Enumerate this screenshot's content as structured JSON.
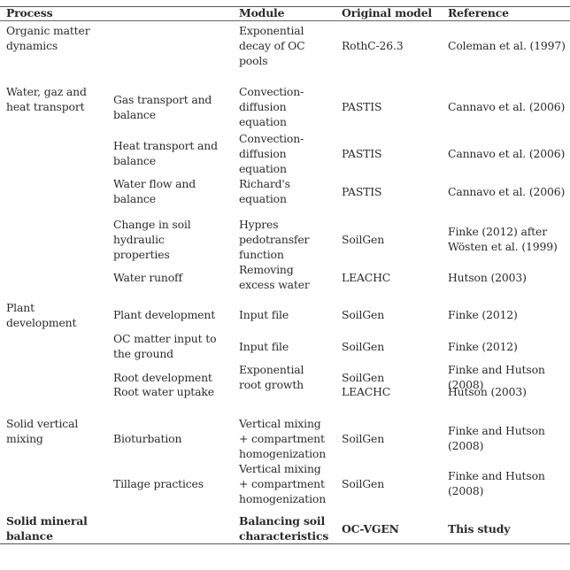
{
  "table": {
    "headers": {
      "process": "Process",
      "submodule": "",
      "module": "Module",
      "original_model": "Original model",
      "reference": "Reference"
    },
    "rows": [
      {
        "process": [
          "Organic matter",
          "dynamics"
        ],
        "submodule": [],
        "module": [
          "Exponential",
          "decay of OC",
          "pools"
        ],
        "original_model": [
          "RothC-26.3"
        ],
        "reference": [
          "Coleman et al.  (1997)"
        ]
      },
      {
        "process": [
          "Water, gaz and",
          "heat transport"
        ],
        "submodule": [
          "Gas transport and",
          "balance"
        ],
        "module": [
          "Convection-",
          "diffusion",
          "equation"
        ],
        "original_model": [
          "PASTIS"
        ],
        "reference": [
          "Cannavo et al. (2006)"
        ]
      },
      {
        "process": [],
        "submodule": [
          "Heat transport and",
          "balance"
        ],
        "module": [
          "Convection-",
          "diffusion",
          "equation"
        ],
        "original_model": [
          "PASTIS"
        ],
        "reference": [
          "Cannavo et al. (2006)"
        ]
      },
      {
        "process": [],
        "submodule": [
          "Water flow and",
          "balance"
        ],
        "module": [
          "Richard's",
          "equation"
        ],
        "original_model": [
          "PASTIS"
        ],
        "reference": [
          "Cannavo et al. (2006)"
        ]
      },
      {
        "process": [],
        "submodule": [
          "Change in soil",
          "hydraulic",
          "properties"
        ],
        "module": [
          "Hypres",
          "pedotransfer",
          "function"
        ],
        "original_model": [
          "SoilGen"
        ],
        "reference": [
          "Finke (2012) after",
          "Wösten et al. (1999)"
        ]
      },
      {
        "process": [],
        "submodule": [
          "Water runoff"
        ],
        "module": [
          "Removing",
          "excess water"
        ],
        "original_model": [
          "LEACHC"
        ],
        "reference": [
          "Hutson (2003)"
        ]
      },
      {
        "process": [
          "Plant",
          "development"
        ],
        "submodule": [
          "Plant development"
        ],
        "module": [
          "Input file"
        ],
        "original_model": [
          "SoilGen"
        ],
        "reference": [
          "Finke (2012)"
        ]
      },
      {
        "process": [],
        "submodule": [
          "OC matter input to",
          "the ground"
        ],
        "module": [
          "Input file"
        ],
        "original_model": [
          "SoilGen"
        ],
        "reference": [
          "Finke (2012)"
        ]
      },
      {
        "process": [],
        "submodule": [
          "Root development"
        ],
        "module": [
          "Exponential",
          "root growth"
        ],
        "original_model": [
          "SoilGen"
        ],
        "reference": [
          "Finke and Hutson",
          "(2008)"
        ]
      },
      {
        "process": [],
        "submodule": [
          "Root water uptake"
        ],
        "module": [],
        "original_model": [
          "LEACHC"
        ],
        "reference": [
          "Hutson (2003)"
        ]
      },
      {
        "process": [
          "Solid vertical",
          "mixing"
        ],
        "submodule": [
          "Bioturbation"
        ],
        "module": [
          "Vertical mixing",
          "+ compartment",
          "homogenization"
        ],
        "original_model": [
          "SoilGen"
        ],
        "reference": [
          "Finke and Hutson",
          "(2008)"
        ]
      },
      {
        "process": [],
        "submodule": [
          "Tillage practices"
        ],
        "module": [
          "Vertical mixing",
          "+ compartment",
          "homogenization"
        ],
        "original_model": [
          "SoilGen"
        ],
        "reference": [
          "Finke and Hutson",
          "(2008)"
        ]
      },
      {
        "process": [
          "Solid mineral",
          "balance"
        ],
        "submodule": [],
        "module": [
          "Balancing soil",
          "characteristics"
        ],
        "original_model": [
          "OC-VGEN"
        ],
        "reference": [
          "This study"
        ],
        "bold": true
      }
    ]
  }
}
